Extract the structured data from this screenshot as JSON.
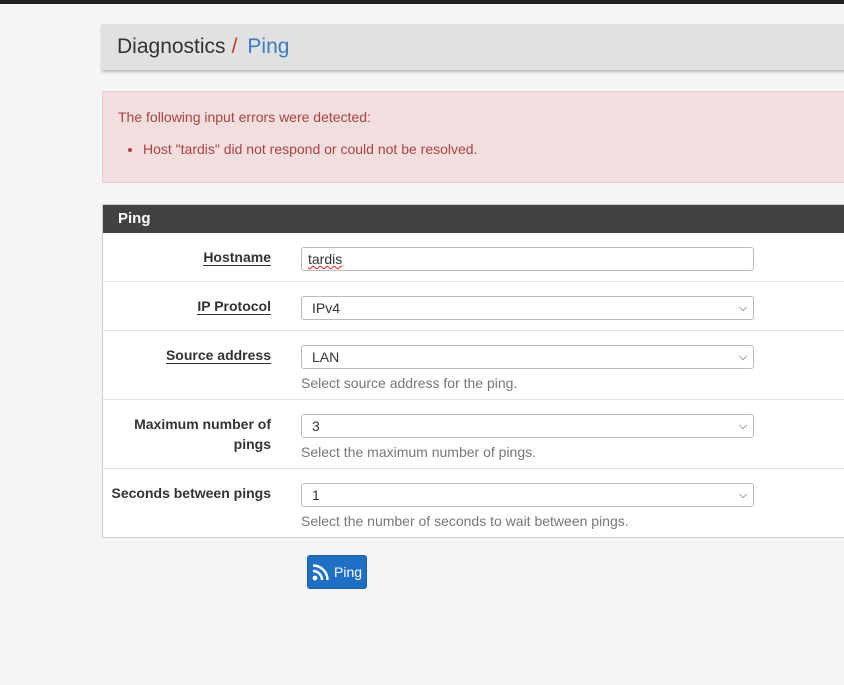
{
  "breadcrumb": {
    "section": "Diagnostics",
    "separator": "/",
    "current": "Ping"
  },
  "alert": {
    "heading": "The following input errors were detected:",
    "errors": [
      "Host \"tardis\" did not respond or could not be resolved."
    ]
  },
  "panel": {
    "title": "Ping",
    "rows": [
      {
        "label": "Hostname",
        "value": "tardis",
        "help": ""
      },
      {
        "label": "IP Protocol",
        "value": "IPv4",
        "help": ""
      },
      {
        "label": "Source address",
        "value": "LAN",
        "help": "Select source address for the ping."
      },
      {
        "label": "Maximum number of pings",
        "value": "3",
        "help": "Select the maximum number of pings."
      },
      {
        "label": "Seconds between pings",
        "value": "1",
        "help": "Select the number of seconds to wait between pings."
      }
    ]
  },
  "button": {
    "label": "Ping",
    "icon": "rss-icon"
  },
  "colors": {
    "accent": "#3a7dc3",
    "error": "#a94442",
    "button": "#1f6fc5"
  }
}
